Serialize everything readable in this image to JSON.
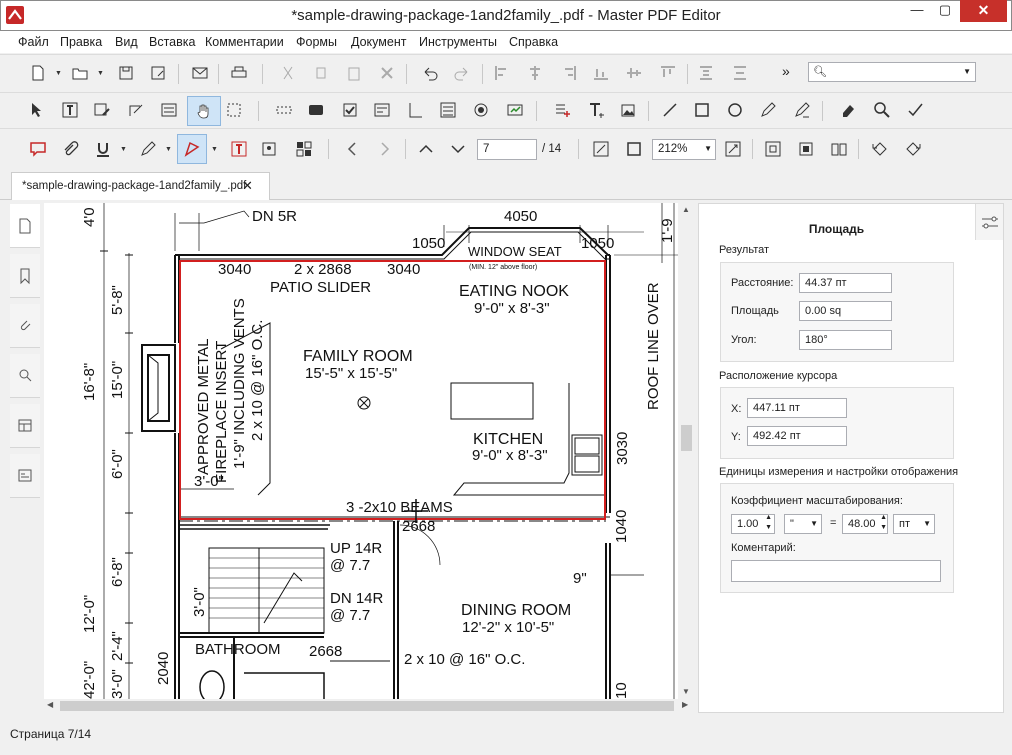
{
  "window": {
    "title": "*sample-drawing-package-1and2family_.pdf - Master PDF Editor",
    "minimize": "—",
    "maximize": "▢",
    "close": "✕"
  },
  "menu": [
    "Файл",
    "Правка",
    "Вид",
    "Вставка",
    "Комментарии",
    "Формы",
    "Документ",
    "Инструменты",
    "Справка"
  ],
  "toolbar": {
    "overflow": "»",
    "search_placeholder": "",
    "page_current": "7",
    "page_total": "/ 14",
    "zoom": "212%"
  },
  "tab": {
    "label": "*sample-drawing-package-1and2family_.pdf",
    "close": "✕"
  },
  "panel": {
    "title": "Площадь",
    "result_label": "Результат",
    "distance_label": "Расстояние:",
    "distance_value": "44.37 пт",
    "area_label": "Площадь",
    "area_value": "0.00 sq",
    "angle_label": "Угол:",
    "angle_value": "180°",
    "cursor_label": "Расположение курсора",
    "x_label": "X:",
    "x_value": "447.11 пт",
    "y_label": "Y:",
    "y_value": "492.42 пт",
    "units_label": "Единицы измерения и настройки отображения",
    "scale_label": "Коэффициент масштабирования:",
    "scale_a": "1.00",
    "scale_unit_a": "\"",
    "equals": "=",
    "scale_b": "48.00",
    "scale_unit_b": "пт",
    "comment_label": "Коментарий:",
    "comment_value": ""
  },
  "status": {
    "page": "Страница 7/14"
  },
  "drawing": {
    "dn5r": "DN 5R",
    "d4050": "4050",
    "d1050a": "1050",
    "window_seat": "WINDOW SEAT",
    "window_seat_note": "(MIN. 12\" above floor)",
    "d1050b": "1050",
    "d3040a": "3040",
    "patio_dim": "2 x 2868",
    "d3040b": "3040",
    "patio": "PATIO SLIDER",
    "nook": "EATING NOOK",
    "nook_dim": "9'-0\" x 8'-3\"",
    "family": "FAMILY ROOM",
    "family_dim": "15'-5\" x 15'-5\"",
    "fireplace1": "APPROVED METAL",
    "fireplace2": "FIREPLACE INSERT",
    "fireplace3": "1'-9\" INCLUDING VENTS",
    "fireplace4": "2 x 10 @ 16\" O.C.",
    "kitchen": "KITCHEN",
    "kitchen_dim": "9'-0\" x 8'-3\"",
    "d3030": "3030",
    "roof": "ROOF LINE OVER",
    "d30": "3'-0\"",
    "beams": "3 -2x10 BEAMS",
    "d2668a": "2668",
    "up": "UP 14R",
    "up_h": "@ 7.7",
    "dn": "DN 14R",
    "dn_h": "@ 7.7",
    "d1040": "1040",
    "d9": "9\"",
    "dining": "DINING ROOM",
    "dining_dim": "12'-2\" x 10'-5\"",
    "bath": "BATHROOM",
    "d2668b": "2668",
    "joists": "2 x 10 @ 16\" O.C.",
    "v40": "4'0",
    "v168": "16'-8\"",
    "v58": "5'-8\"",
    "v150": "15'-0\"",
    "v60": "6'-0\"",
    "v68": "6'-8\"",
    "v120": "12'-0\"",
    "v420": "42'-0\"",
    "v24": "2'-4\"",
    "v30b": "3'-0\"",
    "v30c": "3'-0\"",
    "v2040": "2040",
    "v19": "1'-9",
    "v10": "10"
  }
}
